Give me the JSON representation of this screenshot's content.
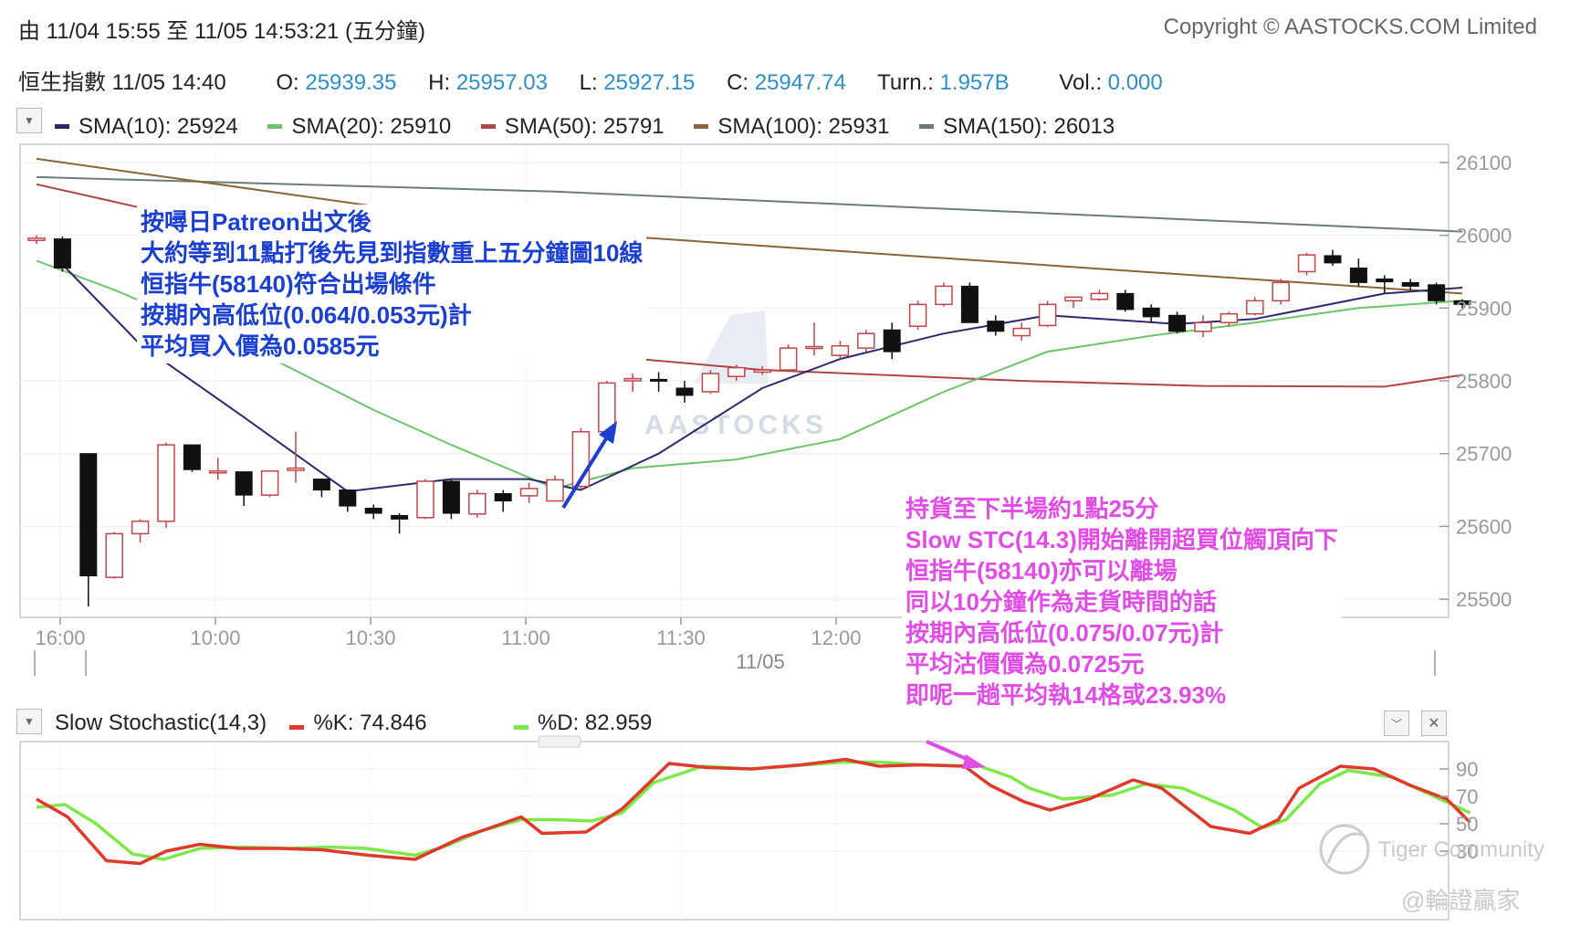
{
  "header": {
    "range": "由  11/04 15:55 至  11/05 14:53:21 (五分鐘)",
    "copyright": "Copyright © AASTOCKS.COM Limited"
  },
  "quote": {
    "name_time": "恒生指數  11/05 14:40",
    "o_label": "O: ",
    "o": "25939.35",
    "h_label": "H: ",
    "h": "25957.03",
    "l_label": "L: ",
    "l": "25927.15",
    "c_label": "C: ",
    "c": "25947.74",
    "turn_label": "Turn.: ",
    "turn": "1.957B",
    "vol_label": "Vol.: ",
    "vol": "0.000"
  },
  "sma_legend": [
    {
      "label": "SMA(10): 25924",
      "color": "#2b2a6e"
    },
    {
      "label": "SMA(20): 25910",
      "color": "#6cc46a"
    },
    {
      "label": "SMA(50): 25791",
      "color": "#b04545"
    },
    {
      "label": "SMA(100): 25931",
      "color": "#8a6535"
    },
    {
      "label": "SMA(150): 26013",
      "color": "#6b7b7b"
    }
  ],
  "stoch_legend": {
    "title": "Slow Stochastic(14,3)",
    "k_label": "%K: 74.846",
    "k_color": "#e0392b",
    "d_label": "%D: 82.959",
    "d_color": "#7ee84a"
  },
  "watermarks": {
    "brand": "AASTOCKS",
    "community": "Tiger Community",
    "handle": "@輪證贏家"
  },
  "annotations": {
    "entry": [
      "按噚日Patreon出文後",
      "大約等到11點打後先見到指數重上五分鐘圖10線",
      "恒指牛(58140)符合出場條件",
      "按期內高低位(0.064/0.053元)計",
      "平均買入價為0.0585元"
    ],
    "exit": [
      "持貨至下半場約1點25分",
      "Slow STC(14.3)開始離開超買位觸頂向下",
      "恒指牛(58140)亦可以離場",
      "同以10分鐘作為走貨時間的話",
      "按期內高低位(0.075/0.07元)計",
      "平均沽價價為0.0725元",
      "即呢一趟平均執14格或23.93%"
    ],
    "entry_color": "#1a3fd1",
    "exit_color": "#e14be6"
  },
  "chart_data": [
    {
      "type": "candlestick",
      "x_ticks": [
        "16:00",
        "10:00",
        "10:30",
        "11:00",
        "11:30",
        "12:00"
      ],
      "date_label": "11/05",
      "y_ticks": [
        26100,
        26000,
        25900,
        25800,
        25700,
        25600,
        25500
      ],
      "ylim": [
        25475,
        26125
      ],
      "up_color": "#c0454b",
      "down_color": "#111111",
      "candles": [
        [
          25993,
          26000,
          25988,
          25996
        ],
        [
          25995,
          25998,
          25950,
          25955
        ],
        [
          25700,
          25700,
          25490,
          25532
        ],
        [
          25530,
          25592,
          25528,
          25590
        ],
        [
          25590,
          25610,
          25578,
          25607
        ],
        [
          25607,
          25715,
          25598,
          25712
        ],
        [
          25712,
          25712,
          25675,
          25678
        ],
        [
          25676,
          25694,
          25664,
          25676
        ],
        [
          25675,
          25675,
          25628,
          25643
        ],
        [
          25643,
          25677,
          25640,
          25676
        ],
        [
          25677,
          25730,
          25660,
          25680
        ],
        [
          25665,
          25665,
          25640,
          25650
        ],
        [
          25650,
          25650,
          25620,
          25628
        ],
        [
          25625,
          25630,
          25610,
          25618
        ],
        [
          25615,
          25618,
          25590,
          25610
        ],
        [
          25612,
          25665,
          25610,
          25662
        ],
        [
          25662,
          25664,
          25610,
          25618
        ],
        [
          25617,
          25650,
          25612,
          25645
        ],
        [
          25645,
          25650,
          25620,
          25635
        ],
        [
          25642,
          25660,
          25632,
          25652
        ],
        [
          25635,
          25670,
          25634,
          25664
        ],
        [
          25655,
          25735,
          25650,
          25730
        ],
        [
          25730,
          25800,
          25725,
          25797
        ],
        [
          25800,
          25810,
          25785,
          25803
        ],
        [
          25802,
          25812,
          25785,
          25800
        ],
        [
          25790,
          25800,
          25770,
          25780
        ],
        [
          25785,
          25815,
          25782,
          25810
        ],
        [
          25806,
          25822,
          25800,
          25818
        ],
        [
          25812,
          25820,
          25808,
          25815
        ],
        [
          25815,
          25850,
          25812,
          25845
        ],
        [
          25845,
          25880,
          25835,
          25847
        ],
        [
          25835,
          25855,
          25830,
          25848
        ],
        [
          25845,
          25870,
          25840,
          25865
        ],
        [
          25870,
          25880,
          25830,
          25840
        ],
        [
          25875,
          25910,
          25870,
          25905
        ],
        [
          25905,
          25935,
          25902,
          25930
        ],
        [
          25930,
          25935,
          25880,
          25880
        ],
        [
          25882,
          25890,
          25862,
          25868
        ],
        [
          25862,
          25880,
          25855,
          25872
        ],
        [
          25876,
          25910,
          25874,
          25905
        ],
        [
          25910,
          25915,
          25900,
          25915
        ],
        [
          25912,
          25925,
          25910,
          25920
        ],
        [
          25920,
          25925,
          25895,
          25898
        ],
        [
          25900,
          25905,
          25880,
          25888
        ],
        [
          25890,
          25895,
          25865,
          25868
        ],
        [
          25868,
          25890,
          25860,
          25880
        ],
        [
          25880,
          25895,
          25875,
          25892
        ],
        [
          25892,
          25915,
          25890,
          25910
        ],
        [
          25910,
          25940,
          25905,
          25935
        ],
        [
          25950,
          25976,
          25945,
          25973
        ],
        [
          25972,
          25980,
          25958,
          25962
        ],
        [
          25955,
          25968,
          25930,
          25935
        ],
        [
          25940,
          25945,
          25920,
          25936
        ],
        [
          25935,
          25940,
          25925,
          25930
        ],
        [
          25932,
          25935,
          25905,
          25910
        ],
        [
          25910,
          25912,
          25900,
          25905
        ]
      ],
      "series": [
        {
          "name": "SMA(150)",
          "color": "#6b7b7b",
          "x": [
            0,
            20,
            55
          ],
          "y": [
            26080,
            26060,
            26005
          ]
        },
        {
          "name": "SMA(100)",
          "color": "#8a6535",
          "x": [
            0,
            20,
            55
          ],
          "y": [
            26105,
            26005,
            25920
          ]
        },
        {
          "name": "SMA(50)",
          "color": "#b04545",
          "x": [
            0,
            10,
            20,
            28,
            38,
            45,
            52,
            55
          ],
          "y": [
            26070,
            25990,
            25840,
            25815,
            25800,
            25793,
            25792,
            25808
          ]
        },
        {
          "name": "SMA(20)",
          "color": "#6cc46a",
          "x": [
            0,
            3,
            8,
            13,
            16,
            20,
            23,
            27,
            31,
            35,
            39,
            43,
            47,
            51,
            55
          ],
          "y": [
            25965,
            25925,
            25850,
            25760,
            25712,
            25652,
            25680,
            25692,
            25720,
            25785,
            25840,
            25862,
            25880,
            25900,
            25910
          ]
        },
        {
          "name": "SMA(10)",
          "color": "#2b2a6e",
          "x": [
            1,
            4,
            8,
            12,
            16,
            19,
            21,
            24,
            28,
            31,
            35,
            39,
            44,
            47,
            52,
            55
          ],
          "y": [
            25960,
            25850,
            25750,
            25648,
            25665,
            25665,
            25650,
            25700,
            25790,
            25830,
            25865,
            25890,
            25878,
            25885,
            25920,
            25928
          ]
        }
      ]
    },
    {
      "type": "line",
      "title": "Slow Stochastic(14,3)",
      "y_ticks": [
        90,
        70,
        50,
        30
      ],
      "ylim": [
        -20,
        110
      ],
      "series": [
        {
          "name": "%K",
          "color": "#e0392b",
          "x": [
            0,
            1.2,
            2.7,
            4,
            5,
            6.3,
            7.8,
            9.4,
            11,
            12.8,
            14.6,
            16.4,
            17.5,
            18.7,
            19.5,
            21.2,
            22.6,
            24.4,
            25.9,
            27.6,
            29.5,
            31.2,
            32.5,
            34.1,
            35.8,
            36.8,
            38.1,
            39.1,
            40.6,
            42.3,
            43.4,
            45.3,
            46.8,
            47.9,
            48.7,
            50.3,
            51.6,
            53,
            54.4,
            55.3
          ],
          "y": [
            68,
            55,
            23,
            21,
            30,
            35,
            32,
            32,
            31,
            27,
            24,
            40,
            47,
            55,
            43,
            44,
            61,
            94,
            91,
            90,
            93,
            97,
            92,
            93,
            92,
            78,
            66,
            60,
            68,
            82,
            76,
            48,
            43,
            53,
            76,
            92,
            90,
            78,
            68,
            51
          ]
        },
        {
          "name": "%D",
          "color": "#7ee84a",
          "x": [
            0,
            1.1,
            2.3,
            3.7,
            4.9,
            6.3,
            7.9,
            9.7,
            11.3,
            12.7,
            14.6,
            15.7,
            17.2,
            18.7,
            20,
            21.4,
            22.6,
            23.8,
            25.7,
            27.5,
            29.7,
            31.1,
            32.5,
            34.1,
            36.4,
            37.6,
            38.3,
            39.6,
            41.5,
            42.8,
            44.2,
            46.2,
            47.3,
            48.2,
            49.5,
            50.6,
            52.3,
            55.3
          ],
          "y": [
            62,
            64,
            50,
            28,
            24,
            32,
            33,
            32,
            33,
            32,
            27,
            33,
            45,
            53,
            53,
            52,
            58,
            80,
            92,
            90,
            93,
            95,
            95,
            93,
            92,
            84,
            76,
            68,
            71,
            79,
            76,
            60,
            47,
            53,
            79,
            89,
            84,
            58
          ]
        }
      ]
    }
  ]
}
